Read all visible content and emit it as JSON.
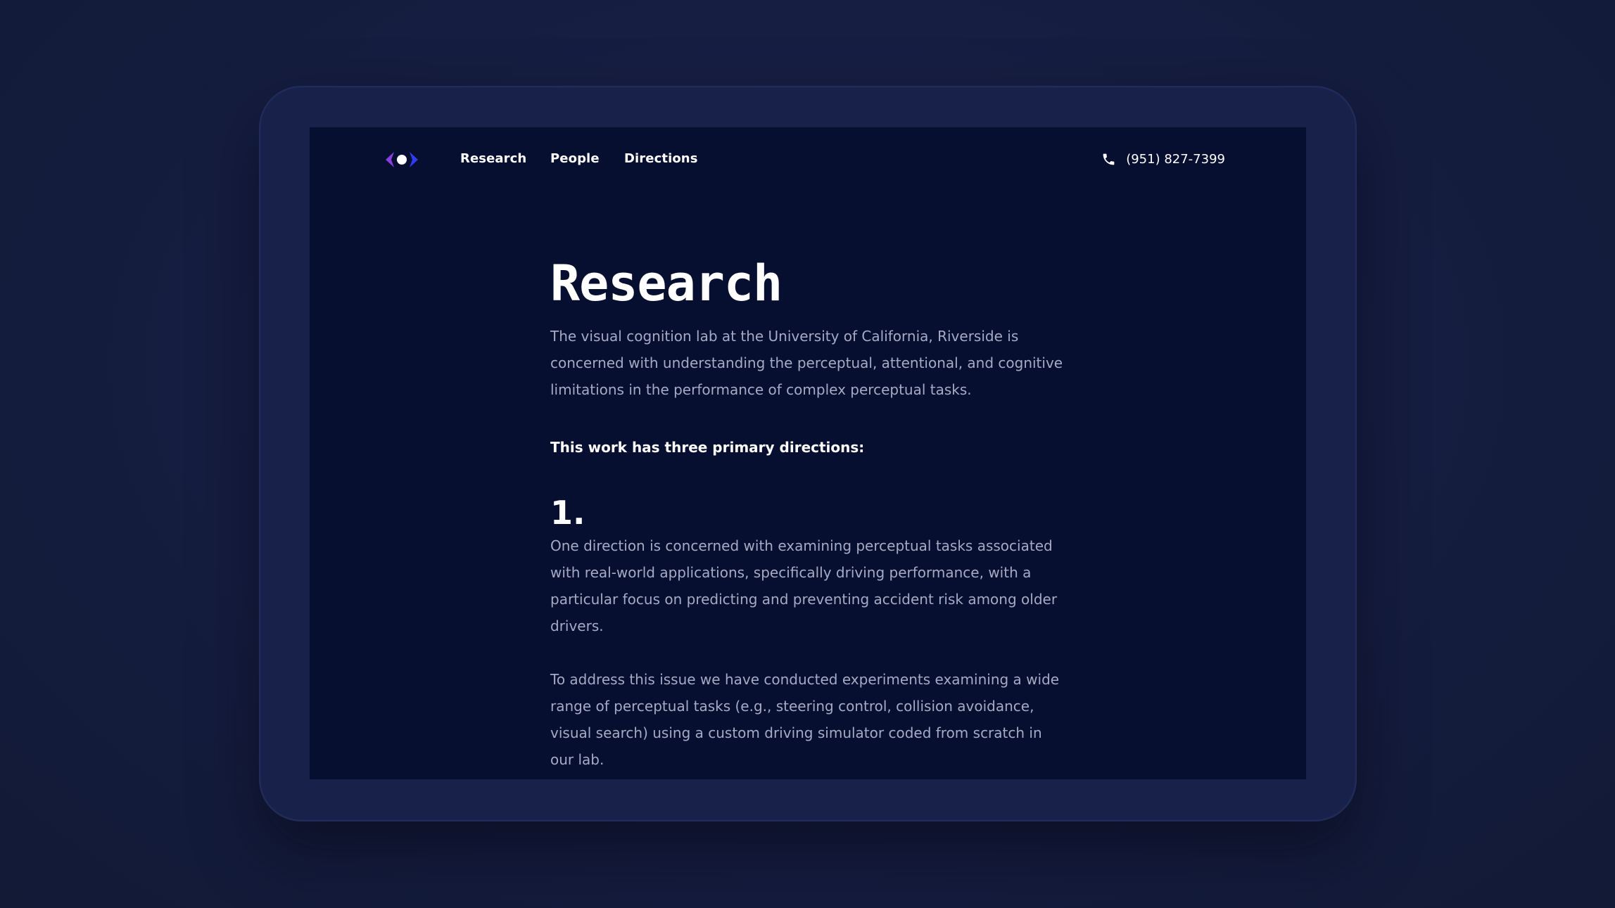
{
  "nav": {
    "items": [
      {
        "label": "Research"
      },
      {
        "label": "People"
      },
      {
        "label": "Directions"
      }
    ],
    "phone": "(951) 827-7399",
    "logo_icon": "eye-logo-icon",
    "phone_icon": "phone-icon"
  },
  "main": {
    "title": "Research",
    "intro": "The visual cognition lab at the University of California, Riverside is concerned with understanding the perceptual, attentional, and cognitive limitations in the performance of complex perceptual tasks.",
    "lead": "This work has three primary directions:",
    "sections": [
      {
        "number": "1.",
        "paragraphs": [
          "One direction is concerned with examining perceptual tasks associated with real-world applications, specifically driving performance, with a particular focus on predicting and preventing accident risk among older drivers.",
          "To address this issue we have conducted experiments examining a wide range of perceptual tasks (e.g., steering control, collision avoidance, visual search) using a custom driving simulator coded from scratch in our lab."
        ]
      }
    ]
  },
  "colors": {
    "page_background": "#151d40",
    "frame": "#18214a",
    "screen_background": "#070f31",
    "body_text": "#a5abc4",
    "heading_text": "#ffffff",
    "logo_purple": "#8a3ee0",
    "logo_blue": "#2f3df0"
  }
}
